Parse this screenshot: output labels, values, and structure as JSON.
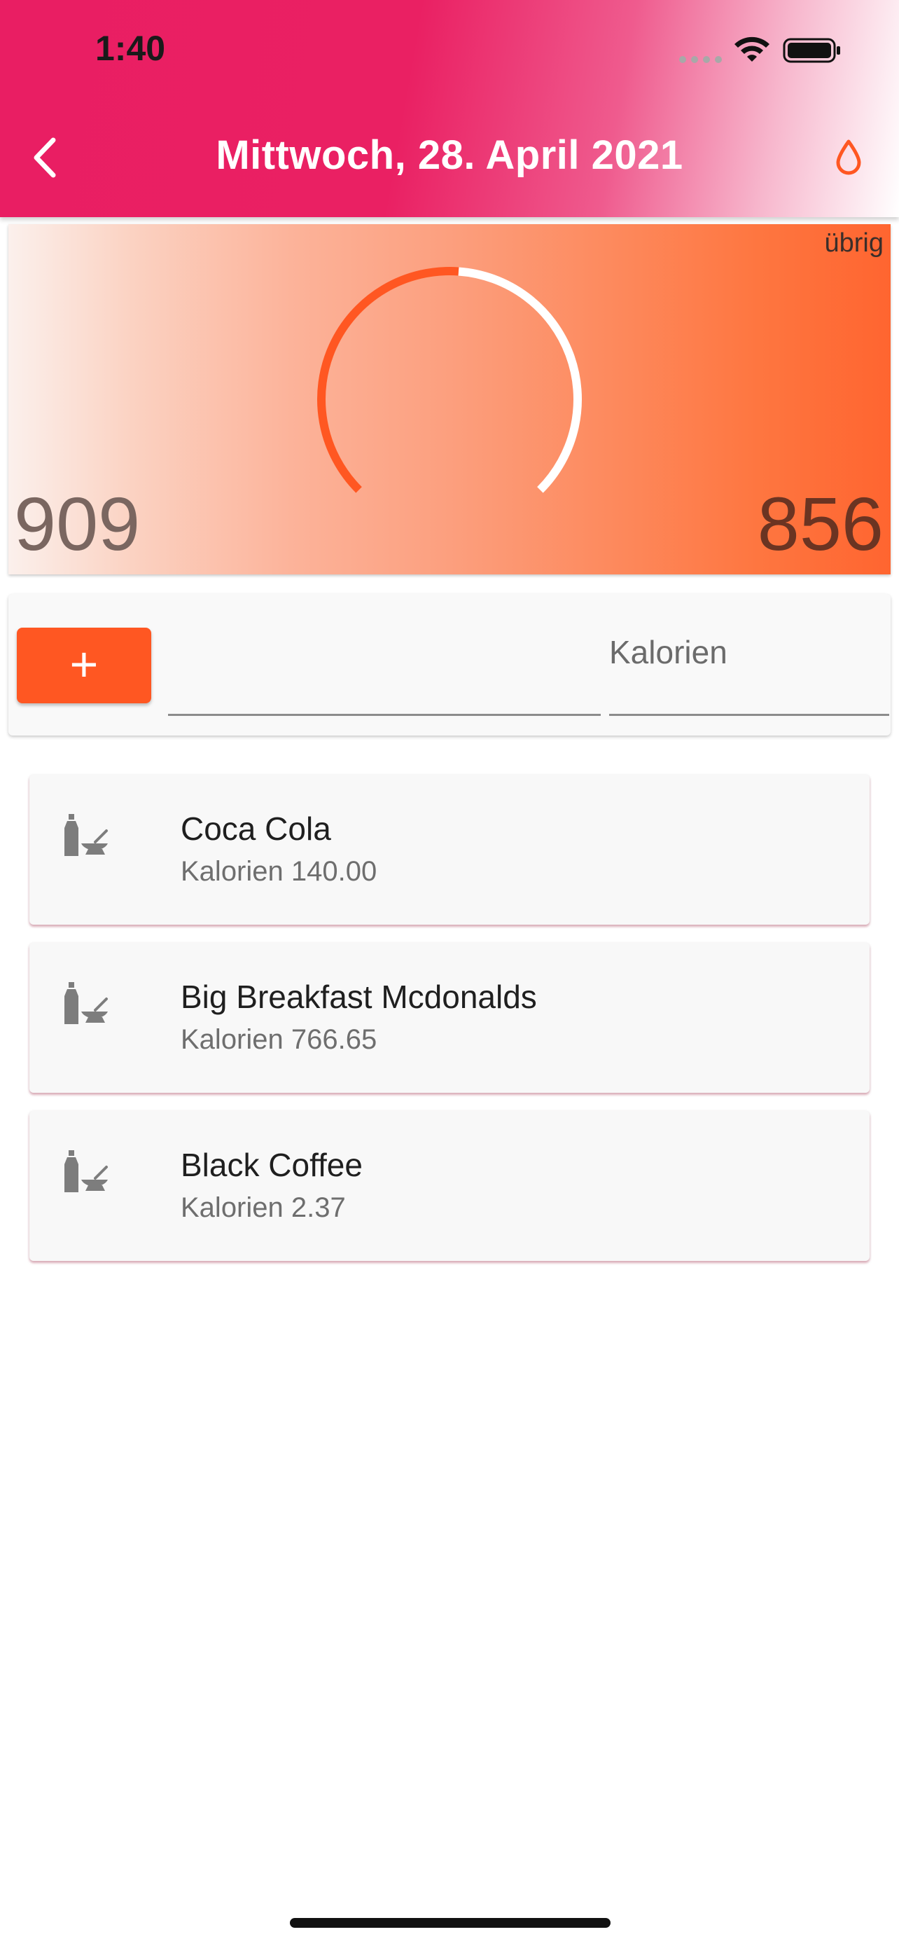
{
  "status_bar": {
    "time": "1:40"
  },
  "header": {
    "title": "Mittwoch, 28. April 2021",
    "back_icon": "chevron-left-icon",
    "action_icon": "water-drop-icon",
    "colors": {
      "primary": "#e91e63",
      "accent": "#ff5722"
    }
  },
  "gauge": {
    "remaining_label": "übrig",
    "consumed": "909",
    "remaining": "856",
    "progress_fraction": 0.515
  },
  "entry": {
    "add_icon": "+",
    "food_value": "",
    "calorie_placeholder": "Kalorien"
  },
  "foods": [
    {
      "name": "Coca Cola",
      "calories": "Kalorien 140.00",
      "icon": "food-icon"
    },
    {
      "name": "Big Breakfast Mcdonalds",
      "calories": "Kalorien 766.65",
      "icon": "food-icon"
    },
    {
      "name": "Black Coffee",
      "calories": "Kalorien 2.37",
      "icon": "food-icon"
    }
  ]
}
